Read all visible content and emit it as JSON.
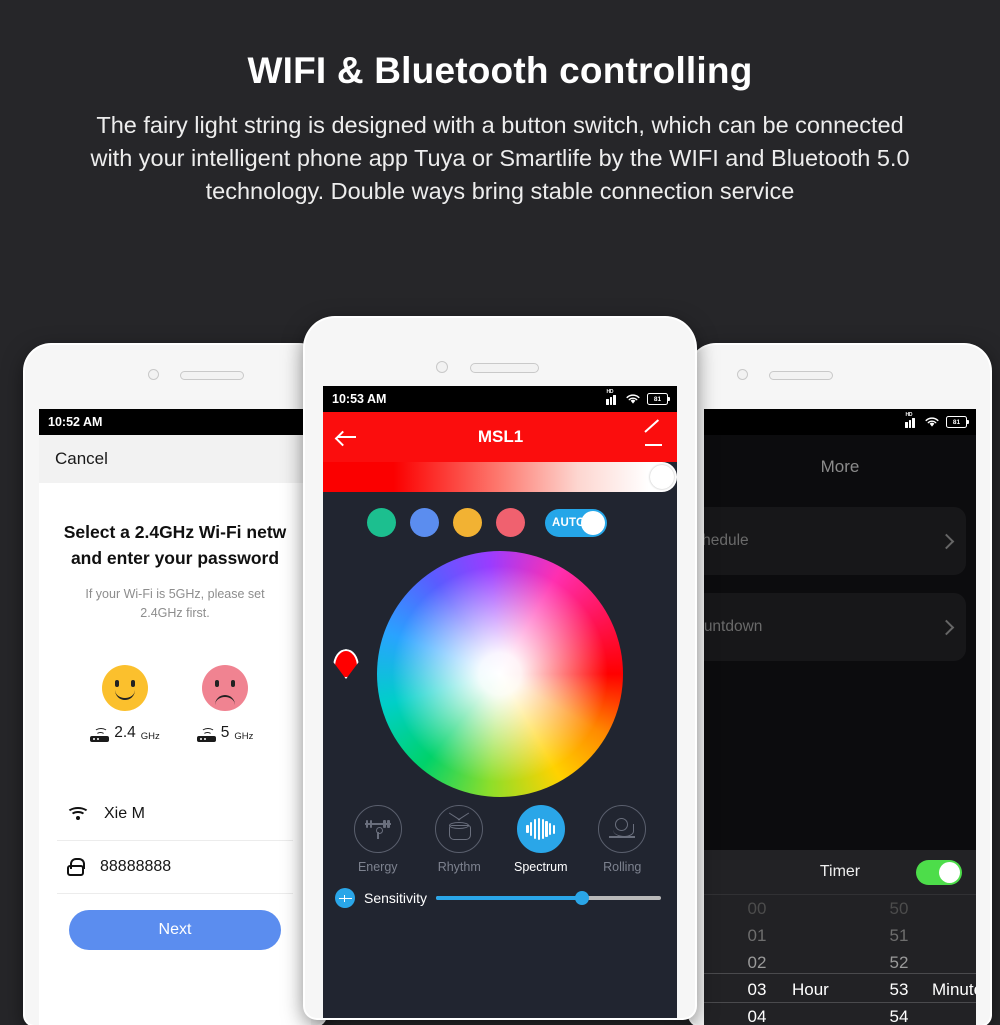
{
  "header": {
    "title": "WIFI & Bluetooth controlling",
    "line1": "The fairy light string is designed with a button switch, which can be connected",
    "line2": "with your intelligent phone app Tuya or Smartlife by the WIFI and Bluetooth 5.0",
    "line3": "technology. Double ways bring stable connection service"
  },
  "left_phone": {
    "status": {
      "time": "10:52 AM"
    },
    "nav": {
      "cancel": "Cancel"
    },
    "heading_line1": "Select a 2.4GHz Wi-Fi netw",
    "heading_line2": "and enter your password",
    "hint_line1": "If your Wi-Fi is 5GHz, please set",
    "hint_line2": "2.4GHz first.",
    "freq_good": "2.4",
    "freq_good_unit": "GHz",
    "freq_bad": "5",
    "freq_bad_unit": "GHz",
    "ssid_value": "Xie M",
    "password_value": "88888888",
    "next_label": "Next"
  },
  "center_phone": {
    "status": {
      "time": "10:53 AM",
      "battery": "81",
      "network": "HD"
    },
    "appbar": {
      "title": "MSL1"
    },
    "brightness": {
      "value": 100
    },
    "swatches": [
      {
        "name": "teal",
        "color": "#1cbf8f"
      },
      {
        "name": "blue",
        "color": "#5b8def"
      },
      {
        "name": "amber",
        "color": "#f2b233"
      },
      {
        "name": "pink",
        "color": "#f0616f"
      }
    ],
    "auto_toggle": {
      "label": "AUTO",
      "on": true,
      "color": "#25a6e8"
    },
    "modes": [
      {
        "label": "Energy",
        "active": false
      },
      {
        "label": "Rhythm",
        "active": false
      },
      {
        "label": "Spectrum",
        "active": true
      },
      {
        "label": "Rolling",
        "active": false
      }
    ],
    "sensitivity": {
      "label": "Sensitivity",
      "value": 65
    }
  },
  "right_phone": {
    "status": {
      "battery": "81",
      "network": "HD"
    },
    "title": "More",
    "rows": [
      {
        "label": "Schedule"
      },
      {
        "label": "Countdown"
      }
    ],
    "timer": {
      "label": "Timer",
      "enabled": true,
      "hour_label": "Hour",
      "minute_label": "Minute",
      "hours": [
        "00",
        "01",
        "02",
        "03",
        "04"
      ],
      "minutes": [
        "50",
        "51",
        "52",
        "53",
        "54"
      ],
      "selected_hour": "03",
      "selected_minute": "53"
    }
  }
}
